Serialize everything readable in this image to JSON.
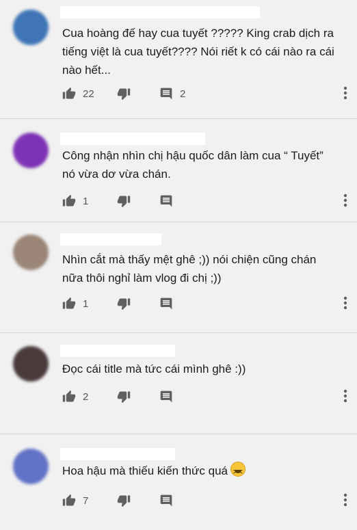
{
  "comments": [
    {
      "text": "Cua hoàng đế hay cua tuyết ????? King crab dịch ra tiếng việt là cua tuyết???? Nói riết k có cái nào ra cái nào hết...",
      "likes": "22",
      "replies": "2",
      "avatar_color": "#3f75b6"
    },
    {
      "text": "Công nhận nhìn chị hậu quốc dân làm cua “ Tuyết”\nnó vừa dơ vừa chán.",
      "likes": "1",
      "replies": "",
      "avatar_color": "#7e33b4"
    },
    {
      "text": "Nhìn cắt mà thấy mệt ghê ;)) nói chiện cũng chán nữa thôi nghỉ làm vlog đi chị ;))",
      "likes": "1",
      "replies": "",
      "avatar_color": "#9a8576"
    },
    {
      "text": "Đọc cái title mà tức cái mình ghê :))",
      "likes": "2",
      "replies": "",
      "avatar_color": "#4a3a3c"
    },
    {
      "text": "Hoa hậu mà thiếu kiến thức quá",
      "likes": "7",
      "replies": "",
      "avatar_color": "#6272c6"
    }
  ]
}
